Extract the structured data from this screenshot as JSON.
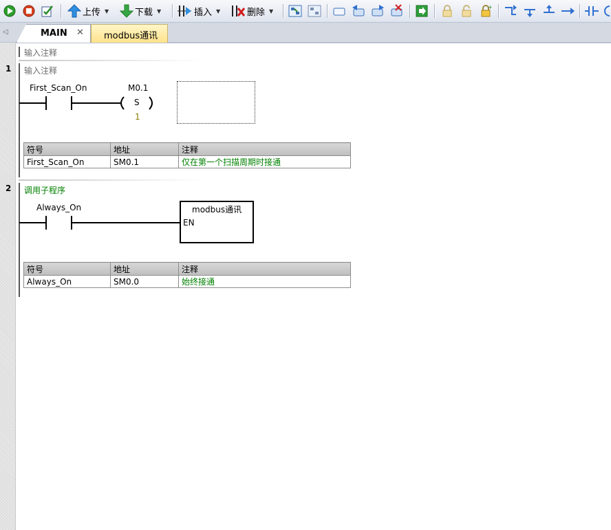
{
  "toolbar": {
    "upload_label": "上传",
    "download_label": "下载",
    "insert_label": "插入",
    "delete_label": "删除"
  },
  "tabs": [
    {
      "label": "MAIN"
    },
    {
      "label": "modbus通讯"
    }
  ],
  "program_comment": "输入注释",
  "networks": [
    {
      "number": "1",
      "comment": "输入注释",
      "contact_label": "First_Scan_On",
      "coil_address": "M0.1",
      "coil_symbol": "S",
      "coil_count": "1",
      "table": {
        "headers": [
          "符号",
          "地址",
          "注释"
        ],
        "rows": [
          [
            "First_Scan_On",
            "SM0.1",
            "仅在第一个扫描周期时接通"
          ]
        ]
      }
    },
    {
      "number": "2",
      "comment": "调用子程序",
      "contact_label": "Always_On",
      "box_title": "modbus通讯",
      "box_input": "EN",
      "table": {
        "headers": [
          "符号",
          "地址",
          "注释"
        ],
        "rows": [
          [
            "Always_On",
            "SM0.0",
            "始终接通"
          ]
        ]
      }
    }
  ],
  "colors": {
    "comment_green": "#008000",
    "comment_gray": "#6e6e6e",
    "tab_active_yellow": "#ffe28a"
  }
}
